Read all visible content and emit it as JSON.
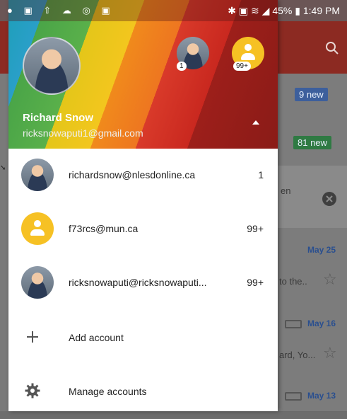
{
  "status_bar": {
    "left_icons": [
      "messenger-icon",
      "gallery-icon",
      "upload-icon",
      "cloud-icon",
      "chrome-icon",
      "camera-icon"
    ],
    "battery": "45%",
    "time": "1:49 PM"
  },
  "background": {
    "badges": [
      "9 new",
      "81 new"
    ],
    "snippets": [
      "en",
      "to the..",
      "ard, Yo..."
    ],
    "dates": [
      "May 25",
      "May 16",
      "May 13"
    ]
  },
  "drawer": {
    "header": {
      "name": "Richard Snow",
      "email": "ricksnowaputi1@gmail.com",
      "secondary_counts": [
        "1",
        "99+"
      ]
    },
    "accounts": [
      {
        "email": "richardsnow@nlesdonline.ca",
        "count": "1"
      },
      {
        "email": "f73rcs@mun.ca",
        "count": "99+"
      },
      {
        "email": "ricksnowaputi@ricksnowaputi...",
        "count": "99+"
      }
    ],
    "menu": {
      "add_account": "Add account",
      "manage_accounts": "Manage accounts"
    }
  },
  "colors": {
    "drawer_bg": "#ffffff",
    "yellow_avatar": "#f6c124",
    "appbar": "#8c2a22",
    "date_blue": "#2a4f8f"
  }
}
